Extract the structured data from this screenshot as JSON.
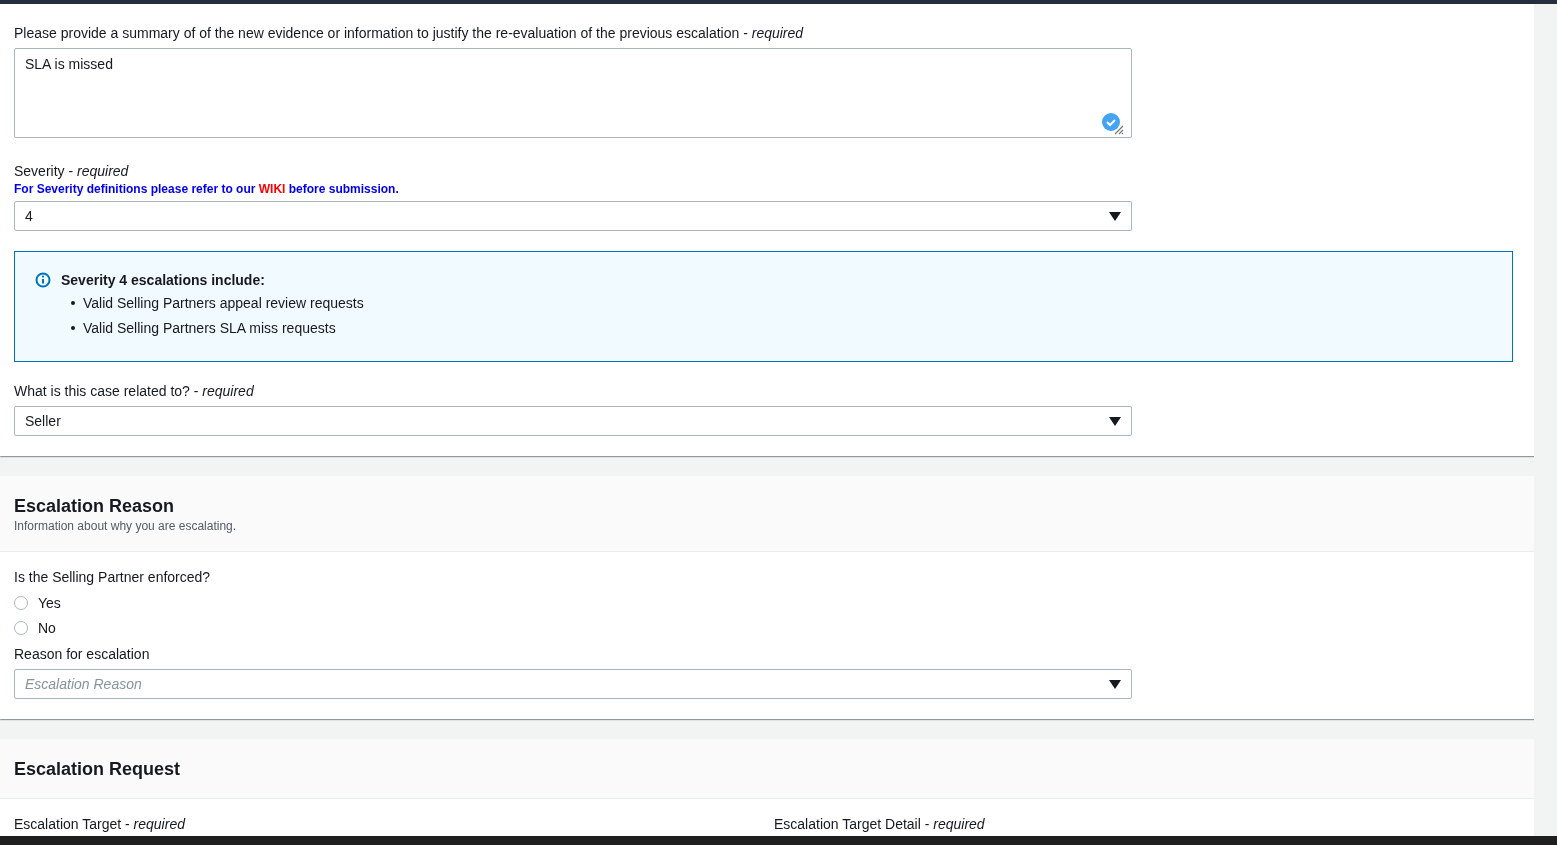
{
  "form_section": {
    "summary": {
      "label": "Please provide a summary of of the new evidence or information to justify the re-evaluation of the previous escalation - *required*",
      "value": "SLA is missed",
      "validated": true
    },
    "severity": {
      "label": "Severity - *required*",
      "note_before": "For Severity definitions please refer to our",
      "note_link": "WIKI",
      "note_after": "before submission.",
      "value": "4"
    },
    "info": {
      "title": "Severity 4 escalations include:",
      "items": [
        "Valid Selling Partners appeal review requests",
        "Valid Selling Partners SLA miss requests"
      ]
    },
    "related": {
      "label": "What is this case related to? - *required*",
      "value": "Seller"
    }
  },
  "escalation_reason": {
    "title": "Escalation Reason",
    "subtitle": "Information about why you are escalating.",
    "question": "Is the Selling Partner enforced?",
    "options": [
      {
        "label": "Yes",
        "selected": false
      },
      {
        "label": "No",
        "selected": false
      }
    ],
    "reason": {
      "label": "Reason for escalation",
      "placeholder": "Escalation Reason"
    }
  },
  "escalation_request": {
    "title": "Escalation Request",
    "fields": [
      {
        "label": "Escalation Target - *required*"
      },
      {
        "label": "Escalation Target Detail - *required*"
      }
    ]
  }
}
